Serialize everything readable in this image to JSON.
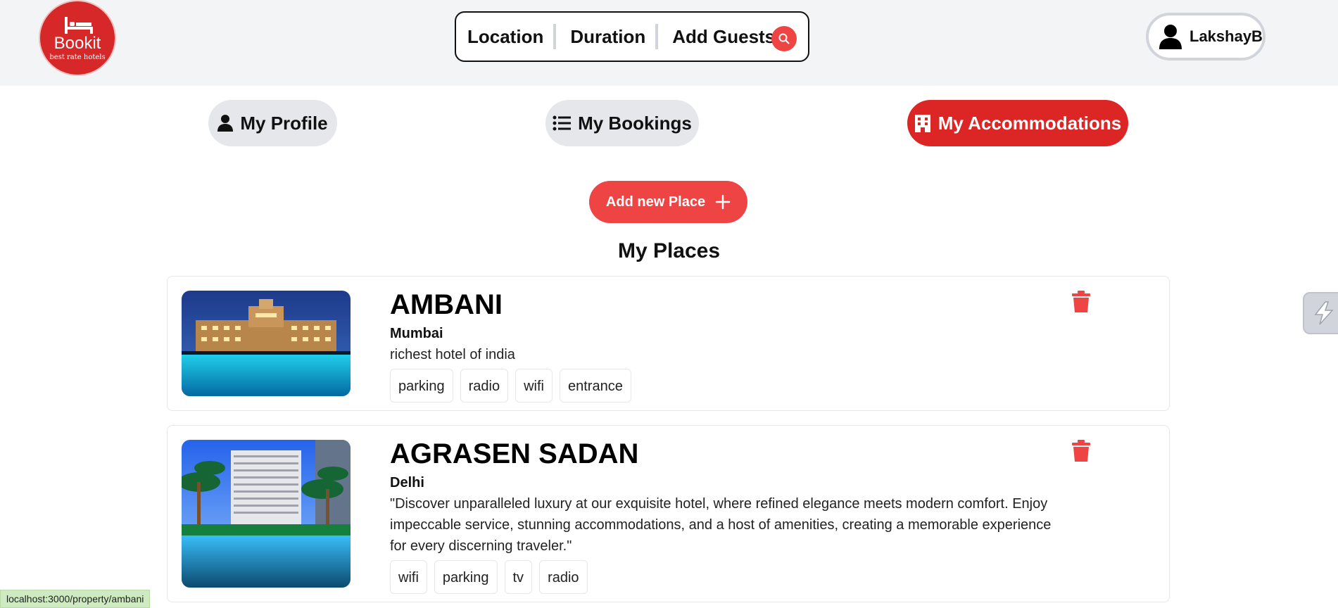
{
  "brand": {
    "name": "Bookit",
    "tagline": "best rate hotels",
    "accent": "#dc2626"
  },
  "search": {
    "location": "Location",
    "duration": "Duration",
    "guests": "Add Guests",
    "icon": "search-icon"
  },
  "user": {
    "name": "LakshayB",
    "icon": "user-icon"
  },
  "tabs": [
    {
      "label": "My Profile",
      "icon": "user-icon",
      "active": false
    },
    {
      "label": "My Bookings",
      "icon": "list-icon",
      "active": false
    },
    {
      "label": "My Accommodations",
      "icon": "building-icon",
      "active": true
    }
  ],
  "add_place": {
    "label": "Add new Place",
    "icon": "plus-icon"
  },
  "section_title": "My Places",
  "places": [
    {
      "title": "AMBANI",
      "city": "Mumbai",
      "description": "richest hotel of india",
      "perks": [
        "parking",
        "radio",
        "wifi",
        "entrance"
      ]
    },
    {
      "title": "AGRASEN SADAN",
      "city": "Delhi",
      "description": "\"Discover unparalleled luxury at our exquisite hotel, where refined elegance meets modern comfort. Enjoy impeccable service, stunning accommodations, and a host of amenities, creating a memorable experience for every discerning traveler.\"",
      "perks": [
        "wifi",
        "parking",
        "tv",
        "radio"
      ]
    }
  ],
  "status_url": "localhost:3000/property/ambani"
}
